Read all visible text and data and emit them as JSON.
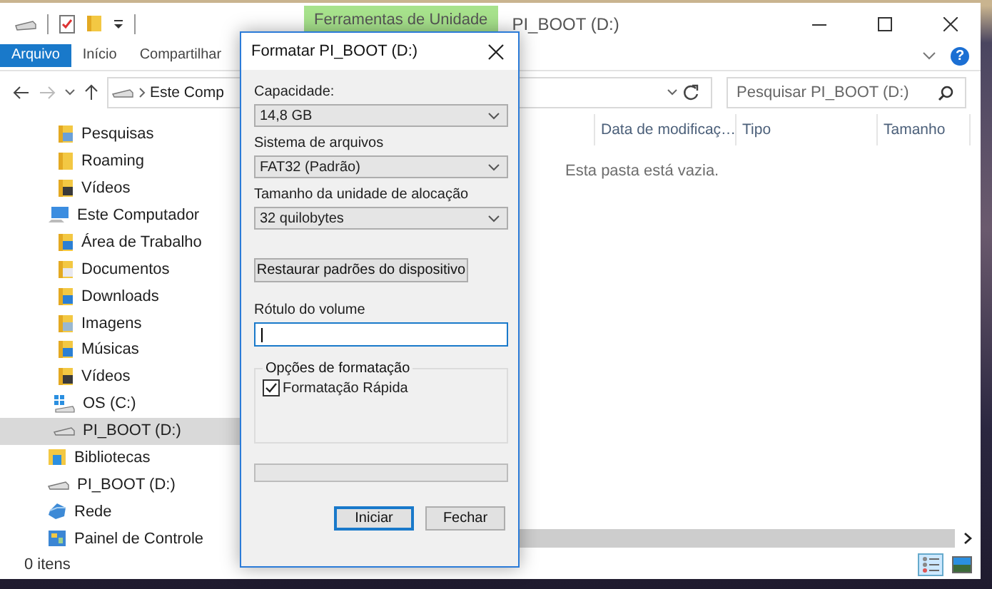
{
  "explorer": {
    "title": "PI_BOOT (D:)",
    "context_tab": "Ferramentas de Unidade",
    "ribbon_tabs": [
      {
        "label": "Arquivo",
        "kind": "file"
      },
      {
        "label": "Início",
        "kind": "tab"
      },
      {
        "label": "Compartilhar",
        "kind": "tab"
      }
    ],
    "help": "?",
    "address": {
      "crumbs": [
        "Este Comp"
      ]
    },
    "search": {
      "placeholder": "Pesquisar PI_BOOT (D:)"
    },
    "nav": {
      "items": [
        {
          "children": [
            {
              "label": "Pesquisas",
              "kind": "search-folder",
              "selected": false
            },
            {
              "label": "Roaming",
              "kind": "folder",
              "selected": false
            },
            {
              "label": "Vídeos",
              "kind": "video-folder",
              "selected": false
            }
          ]
        },
        {
          "label": "Este Computador",
          "kind": "computer",
          "selected": false,
          "children": [
            {
              "label": "Área de Trabalho",
              "kind": "desktop-folder",
              "selected": false
            },
            {
              "label": "Documentos",
              "kind": "docs-folder",
              "selected": false
            },
            {
              "label": "Downloads",
              "kind": "download-folder",
              "selected": false
            },
            {
              "label": "Imagens",
              "kind": "image-folder",
              "selected": false
            },
            {
              "label": "Músicas",
              "kind": "music-folder",
              "selected": false
            },
            {
              "label": "Vídeos",
              "kind": "video-folder",
              "selected": false
            },
            {
              "label": "OS (C:)",
              "kind": "os-drive",
              "selected": false
            },
            {
              "label": "PI_BOOT (D:)",
              "kind": "drive",
              "selected": true
            }
          ]
        },
        {
          "label": "Bibliotecas",
          "kind": "libraries",
          "selected": false
        },
        {
          "label": "PI_BOOT (D:)",
          "kind": "drive",
          "selected": false
        },
        {
          "label": "Rede",
          "kind": "network",
          "selected": false
        },
        {
          "label": "Painel de Controle",
          "kind": "control-panel",
          "selected": false
        }
      ]
    },
    "columns": [
      "Data de modificaç…",
      "Tipo",
      "Tamanho"
    ],
    "empty_message": "Esta pasta está vazia.",
    "status": "0 itens"
  },
  "dialog": {
    "title": "Formatar PI_BOOT (D:)",
    "fields": [
      {
        "label": "Capacidade:",
        "value": "14,8 GB"
      },
      {
        "label": "Sistema de arquivos",
        "value": "FAT32 (Padrão)"
      },
      {
        "label": "Tamanho da unidade de alocação",
        "value": "32 quilobytes"
      }
    ],
    "restore_button": "Restaurar padrões do dispositivo",
    "volume_label": {
      "label": "Rótulo do volume",
      "focused": true
    },
    "options": {
      "title": "Opções de formatação",
      "quick_format": {
        "label": "Formatação Rápida",
        "checked": true
      }
    },
    "progress": {
      "level": 0
    },
    "buttons": [
      {
        "label": "Iniciar",
        "default": true
      },
      {
        "label": "Fechar",
        "default": false
      }
    ]
  }
}
